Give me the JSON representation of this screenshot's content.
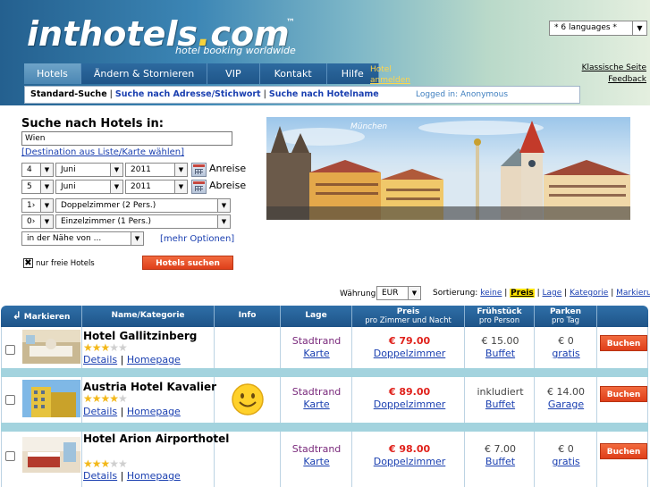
{
  "header": {
    "logo_main": "inthotels",
    "logo_dot": ".",
    "logo_suffix": "com",
    "trademark": "™",
    "slogan": "hotel booking worldwide",
    "language_select": "* 6 languages *",
    "classic_link": "Klassische Seite",
    "feedback_link": "Feedback"
  },
  "nav": {
    "tabs": [
      {
        "label": "Hotels"
      },
      {
        "label": "Ändern & Stornieren"
      },
      {
        "label": "VIP"
      },
      {
        "label": "Kontakt"
      },
      {
        "label": "Hilfe"
      }
    ],
    "hotel_label": "Hotel",
    "hotel_login": "anmelden",
    "search_modes": [
      {
        "label": "Standard-Suche"
      },
      {
        "label": "Suche nach Adresse/Stichwort"
      },
      {
        "label": "Suche nach Hotelname"
      }
    ],
    "logged_in": "Logged in: Anonymous"
  },
  "search": {
    "title": "Suche nach Hotels in:",
    "destination_value": "Wien",
    "destination_link": "[Destination aus Liste/Karte wählen]",
    "arrival": {
      "day": "4",
      "month": "Juni",
      "year": "2011",
      "label": "Anreise"
    },
    "departure": {
      "day": "5",
      "month": "Juni",
      "year": "2011",
      "label": "Abreise"
    },
    "rooms": [
      {
        "count": "1›",
        "type": "Doppelzimmer (2 Pers.)"
      },
      {
        "count": "0›",
        "type": "Einzelzimmer (1 Pers.)"
      }
    ],
    "nearby": "in der Nähe von ...",
    "more_options": "[mehr Optionen]",
    "free_only_label": "nur freie Hotels",
    "free_only_checked": "✖",
    "search_button": "Hotels suchen"
  },
  "banner": {
    "city": "München"
  },
  "sortbar": {
    "currency_label": "Währung:",
    "currency_value": "EUR",
    "sort_label": "Sortierung:",
    "options": [
      {
        "label": "keine"
      },
      {
        "label": "Preis"
      },
      {
        "label": "Lage"
      },
      {
        "label": "Kategorie"
      },
      {
        "label": "Markierung"
      }
    ]
  },
  "table": {
    "headers": {
      "mark": "Markieren",
      "name": "Name/Kategorie",
      "info": "Info",
      "lage": "Lage",
      "price": "Preis",
      "price_sub": "pro Zimmer und Nacht",
      "breakfast": "Frühstück",
      "breakfast_sub": "pro Person",
      "parking": "Parken",
      "parking_sub": "pro Tag"
    },
    "rows": [
      {
        "name": "Hotel Gallitzinberg",
        "stars_on": "★★★",
        "stars_off": "★★",
        "details": "Details",
        "sep": "|",
        "homepage": "Homepage",
        "lage": "Stadtrand",
        "map": "Karte",
        "price": "€ 79.00",
        "room": "Doppelzimmer",
        "breakfast": "€ 15.00",
        "breakfast_type": "Buffet",
        "parking": "€ 0",
        "parking_type": "gratis",
        "book": "Buchen"
      },
      {
        "name": "Austria Hotel Kavalier",
        "stars_on": "★★★★",
        "stars_off": "★",
        "details": "Details",
        "sep": "|",
        "homepage": "Homepage",
        "lage": "Stadtrand",
        "map": "Karte",
        "price": "€ 89.00",
        "room": "Doppelzimmer",
        "breakfast": "inkludiert",
        "breakfast_type": "Buffet",
        "parking": "€ 14.00",
        "parking_type": "Garage",
        "book": "Buchen"
      },
      {
        "name": "Hotel Arion Airporthotel",
        "stars_on": "★★★",
        "stars_off": "★★",
        "details": "Details",
        "sep": "|",
        "homepage": "Homepage",
        "lage": "Stadtrand",
        "map": "Karte",
        "price": "€ 98.00",
        "room": "Doppelzimmer",
        "breakfast": "€ 7.00",
        "breakfast_type": "Buffet",
        "parking": "€ 0",
        "parking_type": "gratis",
        "book": "Buchen"
      }
    ]
  },
  "colors": {
    "accent": "#1e5488",
    "button": "#df3f1a",
    "price": "#e0211b",
    "highlight": "#ffe300"
  }
}
